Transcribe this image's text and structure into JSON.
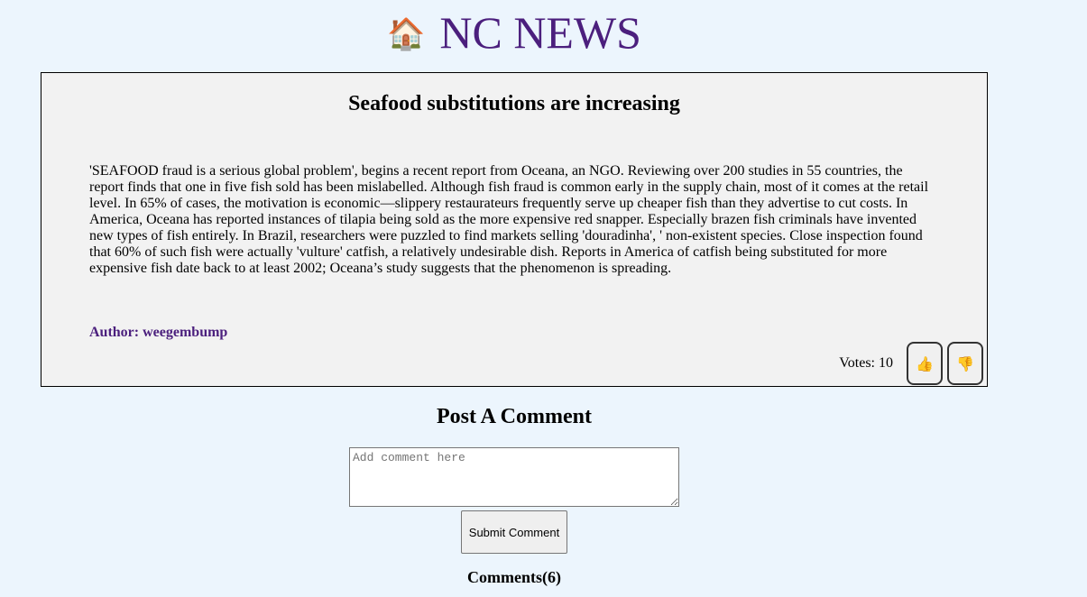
{
  "header": {
    "home_icon": "🏠",
    "title": "NC NEWS"
  },
  "article": {
    "title": "Seafood substitutions are increasing",
    "body": "'SEAFOOD fraud is a serious global problem', begins a recent report from Oceana, an NGO. Reviewing over 200 studies in 55 countries, the report finds that one in five fish sold has been mislabelled. Although fish fraud is common early in the supply chain, most of it comes at the retail level. In 65% of cases, the motivation is economic—slippery restaurateurs frequently serve up cheaper fish than they advertise to cut costs. In America, Oceana has reported instances of tilapia being sold as the more expensive red snapper. Especially brazen fish criminals have invented new types of fish entirely. In Brazil, researchers were puzzled to find markets selling 'douradinha', ' non-existent species. Close inspection found that 60% of such fish were actually 'vulture' catfish, a relatively undesirable dish. Reports in America of catfish being substituted for more expensive fish date back to at least 2002; Oceana’s study suggests that the phenomenon is spreading.",
    "author_label": "Author: weegembump",
    "votes_label": "Votes: 10",
    "upvote_icon": "👍",
    "downvote_icon": "👎"
  },
  "comment_form": {
    "heading": "Post A Comment",
    "placeholder": "Add comment here",
    "submit_label": "Submit Comment"
  },
  "comments": {
    "count_label": "Comments(6)"
  },
  "colors": {
    "page_background": "#ecf5fd",
    "brand_purple": "#4b1f7d",
    "card_background": "#f2f2f2"
  }
}
